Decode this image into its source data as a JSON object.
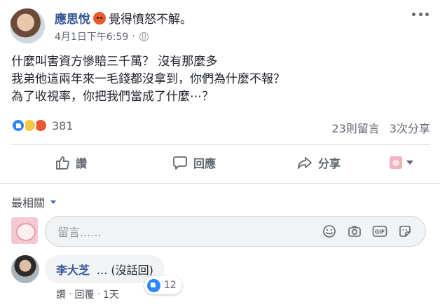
{
  "post": {
    "author": "應思悅",
    "feeling": "覺得憤怒不解。",
    "timestamp": "4月1日下午6:59",
    "dot": "·",
    "body_lines": [
      "什麼叫害資方慘賠三千萬？ 沒有那麼多",
      "我弟他這兩年來一毛錢都沒拿到，你們為什麼不報？",
      "為了收視率，你把我們當成了什麼⋯？"
    ],
    "reactions": {
      "icons": [
        "like",
        "sad",
        "angry"
      ],
      "count": "381"
    },
    "comments_count": "23則留言",
    "shares_count": "3次分享"
  },
  "actions": {
    "like": "讚",
    "comment": "回應",
    "share": "分享"
  },
  "sort": {
    "label": "最相關"
  },
  "composer": {
    "placeholder": "留言......"
  },
  "comment": {
    "author": "李大芝",
    "text": "... (沒話回)",
    "like_label": "讚",
    "reply_label": "回覆",
    "age": "1天",
    "dot": "·",
    "reaction_count": "12"
  },
  "colors": {
    "link_blue": "#365899",
    "like_blue": "#2d88ff",
    "angry": "#e9582e",
    "sad": "#f7c843"
  }
}
